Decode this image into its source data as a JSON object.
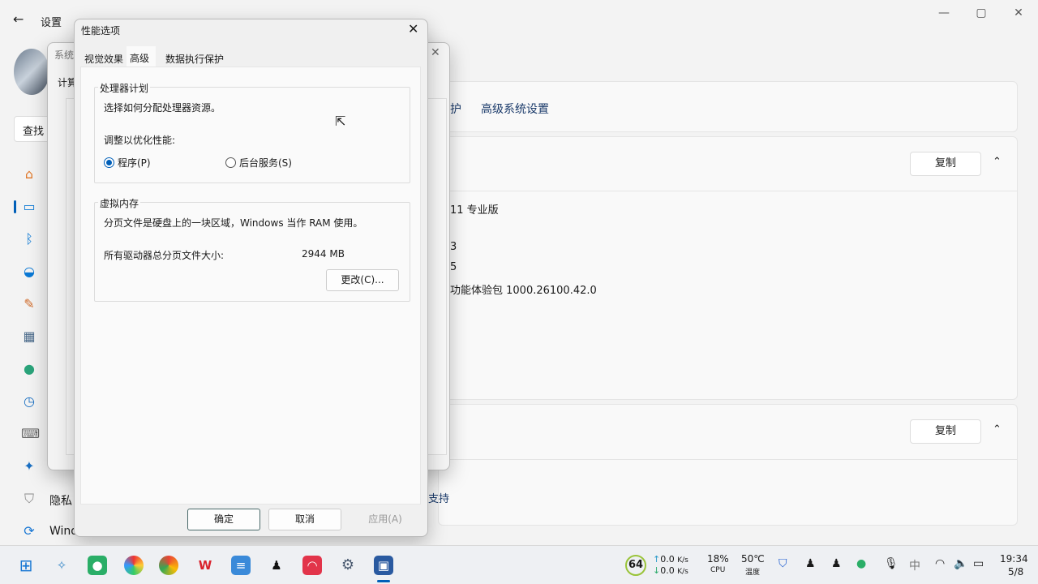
{
  "settings": {
    "title": "设置",
    "search_placeholder": "查找",
    "sidebar_partial": [
      "隐私",
      "Wind"
    ],
    "links": [
      "护",
      "高级系统设置"
    ],
    "copy_label": "复制",
    "spec_lines": [
      "11 专业版",
      "3",
      "5",
      "功能体验包 1000.26100.42.0"
    ],
    "support_partial": "支持"
  },
  "system_dialog": {
    "title": "系统",
    "tab_partial": "计算"
  },
  "perf_dialog": {
    "title": "性能选项",
    "tabs": [
      "视觉效果",
      "高级",
      "数据执行保护"
    ],
    "active_tab": "高级",
    "processor": {
      "group": "处理器计划",
      "desc": "选择如何分配处理器资源。",
      "adjust": "调整以优化性能:",
      "opt_programs": "程序(P)",
      "opt_services": "后台服务(S)",
      "selected": "程序(P)"
    },
    "vmem": {
      "group": "虚拟内存",
      "desc": "分页文件是硬盘上的一块区域，Windows 当作 RAM 使用。",
      "total_label": "所有驱动器总分页文件大小:",
      "total_value": "2944 MB",
      "change": "更改(C)..."
    },
    "ok": "确定",
    "cancel": "取消",
    "apply": "应用(A)"
  },
  "tray": {
    "score": "64",
    "up": "0.0",
    "down": "0.0",
    "unit": "K/s",
    "cpu_pct": "18%",
    "cpu": "CPU",
    "temp": "50℃",
    "temp_label": "温度",
    "time": "19:34",
    "date": "5/8"
  },
  "colors": {
    "accent": "#005fb8"
  }
}
